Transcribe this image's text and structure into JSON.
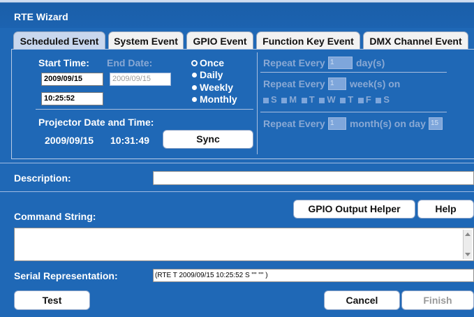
{
  "window": {
    "title": "RTE Wizard"
  },
  "tabs": [
    {
      "label": "Scheduled Event"
    },
    {
      "label": "System Event"
    },
    {
      "label": "GPIO Event"
    },
    {
      "label": "Function Key Event"
    },
    {
      "label": "DMX Channel Event"
    }
  ],
  "schedule": {
    "start_time_label": "Start Time:",
    "end_date_label": "End Date:",
    "start_date_value": "2009/09/15",
    "start_time_value": "10:25:52",
    "end_date_value": "2009/09/15",
    "radios": [
      {
        "label": "Once",
        "selected": true
      },
      {
        "label": "Daily",
        "selected": false
      },
      {
        "label": "Weekly",
        "selected": false
      },
      {
        "label": "Monthly",
        "selected": false
      }
    ],
    "projector_label": "Projector Date and Time:",
    "projector_date": "2009/09/15",
    "projector_time": "10:31:49",
    "sync_label": "Sync"
  },
  "repeat": {
    "daily_prefix": "Repeat Every",
    "daily_value": "1",
    "daily_suffix": "day(s)",
    "weekly_prefix": "Repeat Every",
    "weekly_value": "1",
    "weekly_suffix": "week(s) on",
    "weekdays": [
      "S",
      "M",
      "T",
      "W",
      "T",
      "F",
      "S"
    ],
    "monthly_prefix": "Repeat Every",
    "monthly_value": "1",
    "monthly_middle": "month(s) on day",
    "monthly_day": "15"
  },
  "description": {
    "label": "Description:",
    "value": ""
  },
  "command": {
    "label": "Command String:",
    "gpio_button": "GPIO Output Helper",
    "help_button": "Help",
    "value": ""
  },
  "serial": {
    "label": "Serial Representation:",
    "value": "(RTE T 2009/09/15 10:25:52 S \"\" \"\" )"
  },
  "footer": {
    "test": "Test",
    "cancel": "Cancel",
    "finish": "Finish"
  },
  "colors": {
    "panel_blue": "#1f68b6",
    "title_blue": "#1c63b0"
  }
}
